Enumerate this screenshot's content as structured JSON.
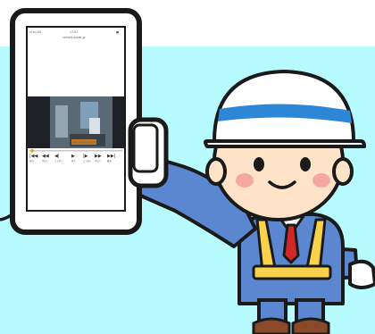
{
  "phone_screen": {
    "status_left": "ıll au 4G",
    "status_time": "17:57",
    "status_right": "■",
    "url": "vehicle-assist.jp",
    "video_timestamp": "2017/03/03 01:01",
    "controls": [
      "|◀◀",
      "◀◀",
      "◀|",
      "▶",
      "|▶",
      "▶▶",
      "▶▶|"
    ],
    "control_labels": [
      "前回",
      "早戻し",
      "コマ戻し",
      "再生",
      "コマ送り",
      "早送り",
      "最新"
    ]
  },
  "colors": {
    "background_band": "#b8fbff",
    "outline": "#1a1a1a",
    "helmet": "#ffffff",
    "helmet_stripe": "#2e86d6",
    "skin": "#ffe3c8",
    "cheek": "#f5a8a0",
    "uniform": "#5b86d0",
    "vest": "#f8d24a",
    "tie": "#d02828",
    "gloves": "#ffffff"
  },
  "icons": [
    "smartphone-icon",
    "security-guard-icon"
  ]
}
